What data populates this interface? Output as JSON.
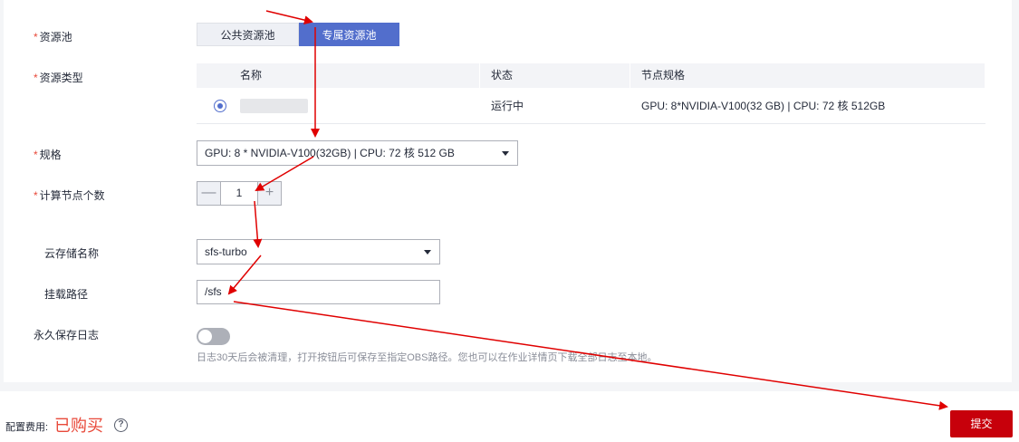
{
  "form": {
    "pool_label": "资源池",
    "pool_options": [
      "公共资源池",
      "专属资源池"
    ],
    "resource_type_label": "资源类型",
    "spec_label": "规格",
    "spec_value": "GPU: 8 * NVIDIA-V100(32GB) | CPU: 72 核 512 GB",
    "node_count_label": "计算节点个数",
    "node_count_value": "1",
    "step_minus": "—",
    "step_plus": "+",
    "storage_label": "云存储名称",
    "storage_value": "sfs-turbo",
    "mount_label": "挂载路径",
    "mount_value": "/sfs",
    "log_label": "永久保存日志",
    "log_hint": "日志30天后会被清理，打开按钮后可保存至指定OBS路径。您也可以在作业详情页下载全部日志至本地。",
    "required_mark": "*"
  },
  "table": {
    "headers": [
      "名称",
      "状态",
      "节点规格"
    ],
    "rows": [
      {
        "name": "",
        "status": "运行中",
        "spec": "GPU: 8*NVIDIA-V100(32 GB) | CPU: 72 核 512GB"
      }
    ]
  },
  "footer": {
    "fee_label": "配置费用:",
    "fee_value": "已购买",
    "help": "?",
    "submit_label": "提交"
  },
  "colors": {
    "accent": "#526ecc",
    "danger": "#c7000b",
    "annotation": "#e00000"
  },
  "state": {
    "log_toggle_on": false,
    "selected_pool": "专属资源池"
  }
}
